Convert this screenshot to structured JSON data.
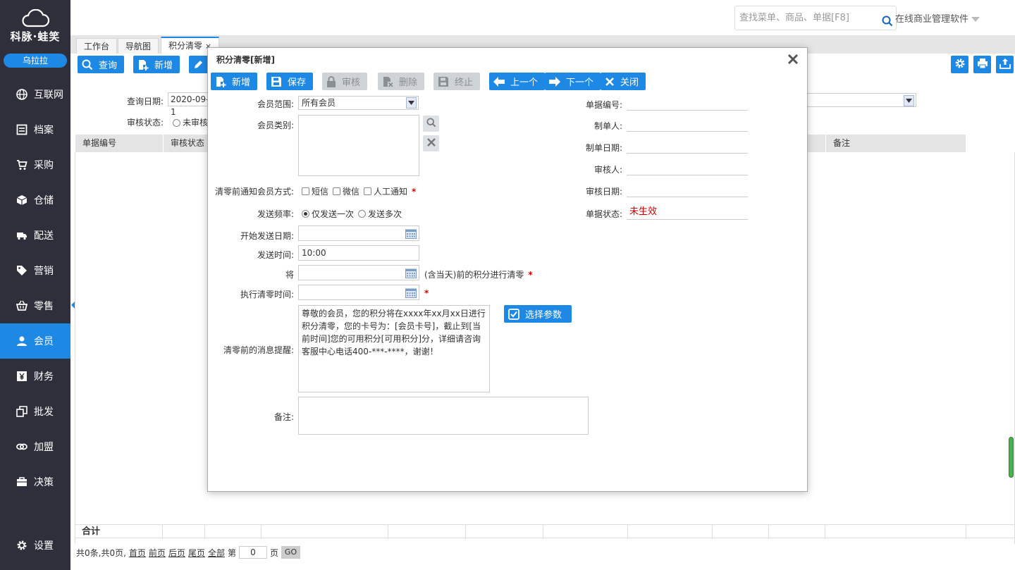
{
  "sidebar": {
    "logo_text": "科脉·蛙笑",
    "user": "乌拉拉",
    "items": [
      {
        "label": "互联网",
        "icon": "globe-icon"
      },
      {
        "label": "档案",
        "icon": "archive-icon"
      },
      {
        "label": "采购",
        "icon": "cart-icon"
      },
      {
        "label": "仓储",
        "icon": "box-icon"
      },
      {
        "label": "配送",
        "icon": "truck-icon"
      },
      {
        "label": "营销",
        "icon": "tag-icon"
      },
      {
        "label": "零售",
        "icon": "basket-icon"
      },
      {
        "label": "会员",
        "icon": "user-icon"
      },
      {
        "label": "财务",
        "icon": "yen-icon"
      },
      {
        "label": "批发",
        "icon": "copy-icon"
      },
      {
        "label": "加盟",
        "icon": "link-icon"
      },
      {
        "label": "决策",
        "icon": "briefcase-icon"
      }
    ],
    "settings": "设置"
  },
  "topbar": {
    "search_placeholder": "查找菜单、商品、单据[F8]",
    "app_title": "在线商业管理软件"
  },
  "tabs": [
    "工作台",
    "导航图",
    "积分清零"
  ],
  "toolbar": {
    "query": "查询",
    "add": "新增"
  },
  "query": {
    "date_label": "查询日期:",
    "date_value": "2020-09-1",
    "audit_label": "审核状态:",
    "audit_option": "未审核"
  },
  "table": {
    "headers": [
      "单据编号",
      "审核状态",
      "",
      "备注"
    ],
    "sum_label": "合计"
  },
  "pager": {
    "summary": "共0条,共0页,",
    "first": "首页",
    "prev": "前页",
    "next": "后页",
    "last": "尾页",
    "all": "全部",
    "page_prefix": "第",
    "page_value": "0",
    "page_suffix": "页",
    "go": "GO"
  },
  "modal": {
    "title": "积分清零[新增]",
    "buttons": {
      "add": "新增",
      "save": "保存",
      "audit": "审核",
      "delete": "删除",
      "stop": "终止",
      "prev": "上一个",
      "next": "下一个",
      "close": "关闭"
    },
    "member_scope_label": "会员范围:",
    "member_scope_value": "所有会员",
    "member_type_label": "会员类别:",
    "notify_label": "清零前通知会员方式:",
    "notify_options": [
      "短信",
      "微信",
      "人工通知"
    ],
    "freq_label": "发送频率:",
    "freq_options": [
      "仅发送一次",
      "发送多次"
    ],
    "start_date_label": "开始发送日期:",
    "send_time_label": "发送时间:",
    "send_time_value": "10:00",
    "clear_prefix_label": "将",
    "clear_suffix": "(含当天)前的积分进行清零",
    "exec_time_label": "执行清零时间:",
    "message_label": "清零前的消息提醒:",
    "message_value": "尊敬的会员，您的积分将在xxxx年xx月xx日进行积分清零，您的卡号为：[会员卡号]，截止到[当前时间]您的可用积分[可用积分]分，详细请咨询客服中心电话400-***-****，谢谢！",
    "select_param": "选择参数",
    "remark_label": "备注:",
    "right": {
      "doc_no_label": "单据编号:",
      "creator_label": "制单人:",
      "create_date_label": "制单日期:",
      "auditor_label": "审核人:",
      "audit_date_label": "审核日期:",
      "status_label": "单据状态:",
      "status_value": "未生效"
    }
  },
  "colors": {
    "sidebar_bg": "#2e2f3b",
    "accent": "#1e88e5",
    "status_red": "#d00000"
  }
}
